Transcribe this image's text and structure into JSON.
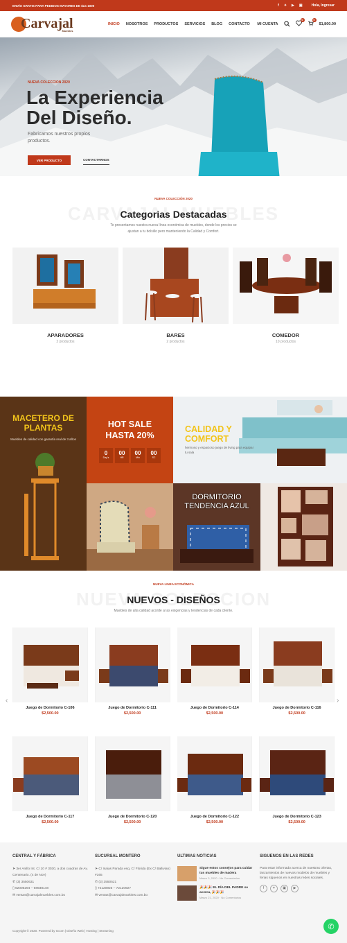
{
  "topbar": {
    "promo": "ENVÍO GRATIS PARA PEDIDOS MAYORES DE $us 1000",
    "social": [
      "f",
      "✦",
      "▶",
      "▣"
    ],
    "login": "Hola, Ingresar"
  },
  "nav": {
    "logo": "Carvajal",
    "logo_sub": "Muebles",
    "items": [
      "INICIO",
      "NOSOTROS",
      "PRODUCTOS",
      "SERVICIOS",
      "BLOG",
      "CONTACTO"
    ],
    "account": "MI CUENTA",
    "wish_count": "0",
    "cart_count": "0",
    "cart_total": "$1,800.00"
  },
  "hero": {
    "subtitle": "NUEVA COLECCION 2020",
    "title_line1": "La Experiencia",
    "title_line2": "Del Diseño.",
    "description": "Fabricamos nuestros propios productos.",
    "cta_primary": "VER PRODUCTO",
    "cta_secondary": "CONTACTARNOS"
  },
  "categories": {
    "subtitle": "NUEVA COLECCIÓN 2020",
    "bg_text": "CARVAJAL MUEBLES",
    "title": "Categorias Destacadas",
    "description": "Te presentamos nuestra nueva línea económica de muebles, donde los precios se ajustan a tu bolsillo pero manteniendo la Calidad y Comfort.",
    "items": [
      {
        "name": "APARADORES",
        "count": "2 productos"
      },
      {
        "name": "BARES",
        "count": "2 productos"
      },
      {
        "name": "COMEDOR",
        "count": "10 productos"
      }
    ]
  },
  "promo": {
    "macetero_title": "MACETERO DE PLANTAS",
    "macetero_desc": "Muebles de calidad con garantía real de 3 años",
    "hotsale_title": "HOT SALE HASTA 20%",
    "countdown": [
      {
        "value": "0",
        "unit": "Day's"
      },
      {
        "value": "00",
        "unit": "HR"
      },
      {
        "value": "00",
        "unit": "Min"
      },
      {
        "value": "00",
        "unit": "SC"
      }
    ],
    "calidad_title": "CALIDAD Y COMFORT",
    "calidad_desc": "hermoso y espacioso juego de living para equipar tu sala",
    "dormitorio_title": "DORMITORIO TENDENCIA AZUL"
  },
  "nuevos": {
    "subtitle": "NUEVA LINEA ECONÓMICA",
    "bg_text": "NUEVA COLECCION",
    "title": "NUEVOS - DISEÑOS",
    "description": "Muebles de alta calidad acorde a las exigencias y tendencias de cada cliente.",
    "products": [
      {
        "name": "Juego de Dormitorio C-106",
        "price": "$2,500.00"
      },
      {
        "name": "Juego de Dormitorio C-111",
        "price": "$2,500.00"
      },
      {
        "name": "Juego de Dormitorio C-114",
        "price": "$2,500.00"
      },
      {
        "name": "Juego de Dormitorio C-116",
        "price": "$2,500.00"
      },
      {
        "name": "Juego de Dormitorio C-117",
        "price": "$2,500.00"
      },
      {
        "name": "Juego de Dormitorio C-120",
        "price": "$2,500.00"
      },
      {
        "name": "Juego de Dormitorio C-122",
        "price": "$2,500.00"
      },
      {
        "name": "Juego de Dormitorio C-123",
        "price": "$2,500.00"
      }
    ]
  },
  "footer": {
    "col1": {
      "title": "CENTRAL Y FÁBRICA",
      "address": "3er Anillo Int. C/ 10 # 3030, a dos cuadras de Av. Centenario. (4 de Nov)",
      "phone1": "(3) 3550631",
      "phone2": "62006294 – 68938148",
      "email": "ventas@carvajalmuebles.com.bo"
    },
    "col2": {
      "title": "SUCURSAL MONTERO",
      "address": "C/ Isaias Parada esq. C/ Florida (Ex C/ Ballivian) #165",
      "phone1": "(3) 3550521",
      "phone2": "72120926 – 72120927",
      "email": "ventas@carvajalmuebles.com.bo"
    },
    "col3": {
      "title": "ULTIMAS NOTICIAS",
      "news": [
        {
          "title": "Sigue estos consejos para cuidar tus muebles de madera",
          "date": "Marzo 3, 2020",
          "comments": "No Comentarios"
        },
        {
          "title": "🎉🎉🎉 EL DÍA DEL PADRE se acerca, 🎉🎉🎉",
          "date": "Marzo 21, 2020",
          "comments": "No Comentarios"
        }
      ]
    },
    "col4": {
      "title": "SIGUENOS EN LAS REDES",
      "text": "Para estar informado acerca de nuestras ofertas, lanzamientos de nuevos modelos de muebles y ferias síguenos en nuestras redes sociales.",
      "social": [
        "f",
        "✦",
        "▣",
        "▶"
      ]
    },
    "copyright": "Copyright © 2020. Powered by Gcom | Diseño Web | Hosting | Streaming"
  }
}
